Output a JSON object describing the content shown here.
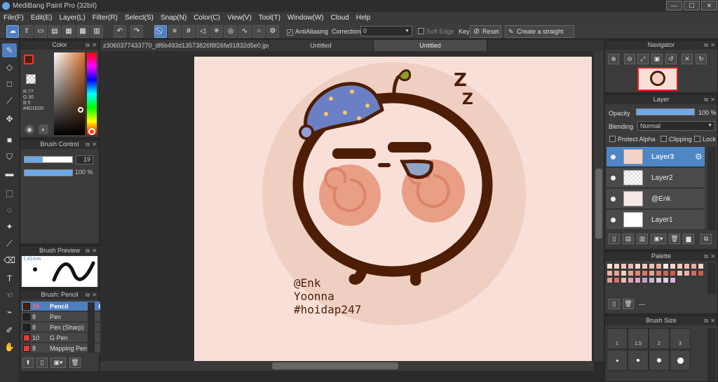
{
  "app": {
    "title": "MediBang Paint Pro (32bit)"
  },
  "window_buttons": {
    "minimize": "—",
    "maximize": "☐",
    "close": "✕"
  },
  "menu": [
    "File(F)",
    "Edit(E)",
    "Layer(L)",
    "Filter(R)",
    "Select(S)",
    "Snap(N)",
    "Color(C)",
    "View(V)",
    "Tool(T)",
    "Window(W)",
    "Cloud",
    "Help"
  ],
  "toolbar": {
    "antialiasing": "AntiAliasing",
    "correction_label": "Correction",
    "correction_value": "0",
    "soft_edge": "Soft Edge",
    "key": "Key",
    "reset": "Reset",
    "straight_line": "Create a straight line"
  },
  "color_panel": {
    "title": "Color",
    "r": "R:77",
    "g": "G:30",
    "b": "B:5",
    "hex": "#4D1E05",
    "foreground": "#4d1e05",
    "background": "#ffffff"
  },
  "brush_control": {
    "title": "Brush Control",
    "size": "19",
    "opacity": "100 %"
  },
  "brush_preview": {
    "title": "Brush Preview",
    "size": "1.41mm"
  },
  "brush_list": {
    "title": "Brush: Pencil",
    "items": [
      {
        "size": "19",
        "name": "Pencil",
        "color": "#4d1e05",
        "selected": true
      },
      {
        "size": "8",
        "name": "Pen",
        "color": "#222222",
        "selected": false
      },
      {
        "size": "8",
        "name": "Pen (Sharp)",
        "color": "#222222",
        "selected": false
      },
      {
        "size": "10",
        "name": "G Pen",
        "color": "#e53935",
        "selected": false
      },
      {
        "size": "8",
        "name": "Mapping Pen",
        "color": "#e53935",
        "selected": false
      }
    ]
  },
  "tabs": [
    "z3060377433770_df6b493d13573826f8f26fa91832d5e0.jpg",
    "Untitled",
    "Untitled"
  ],
  "artwork": {
    "sleep": "Z",
    "watermark": [
      "@Enk",
      "Yoonna",
      "#hoidap247"
    ]
  },
  "navigator": {
    "title": "Navigator"
  },
  "layer_panel": {
    "title": "Layer",
    "opacity_label": "Opacity",
    "opacity_value": "100 %",
    "blending_label": "Blending",
    "blending_value": "Normal",
    "protect_alpha": "Protect Alpha",
    "clipping": "Clipping",
    "lock": "Lock",
    "layers": [
      {
        "name": "Layer3",
        "selected": true
      },
      {
        "name": "Layer2",
        "selected": false
      },
      {
        "name": "@Enk",
        "selected": false
      },
      {
        "name": "Layer1",
        "selected": false
      }
    ]
  },
  "palette": {
    "title": "Palette",
    "name": "---",
    "swatches": [
      "#f9e0dc",
      "#f7d0c8",
      "#f3c4ba",
      "#efb5aa",
      "#f8d6d0",
      "#f5c8c0",
      "#f2bdb4",
      "#eeaca2",
      "#fbe7e4",
      "#f6d3cb",
      "#f4c9bf",
      "#efb9ae",
      "#e9a89b",
      "#f5d2ca",
      "#eab0a4",
      "#e9a293",
      "#f1cbc2",
      "#e6a193",
      "#dd8775",
      "#d9776a",
      "#e8a294",
      "#d87768",
      "#d06655",
      "#cc5b4a",
      "#efc4ba",
      "#e9b4a8",
      "#d26e5e",
      "#c95b4b",
      "#e19e8f",
      "#d4715f",
      "#e8b9b8",
      "#d8a0b8",
      "#d7a6c4",
      "#caa0c8",
      "#c7b5d9",
      "#dcc5e2",
      "#e4cde6",
      "#d6b8de"
    ]
  },
  "brush_size": {
    "title": "Brush Size",
    "sizes": [
      "1",
      "1.5",
      "2",
      "3"
    ]
  }
}
